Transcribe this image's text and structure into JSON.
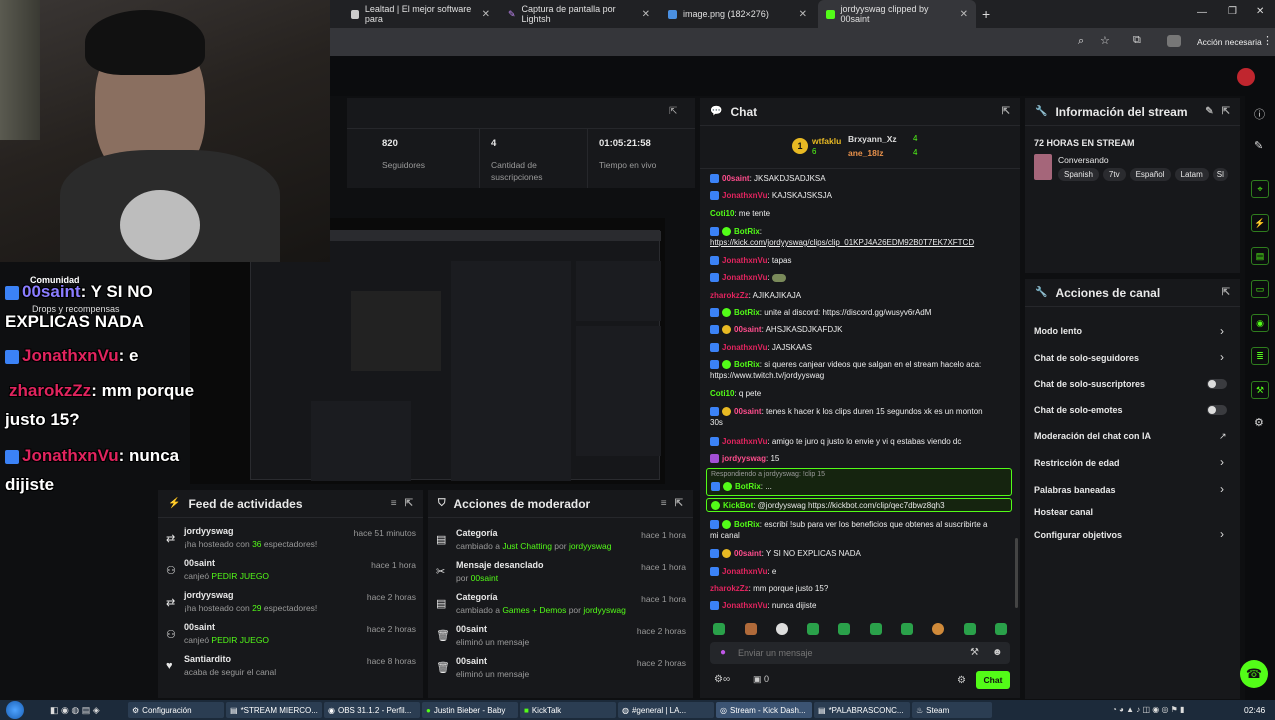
{
  "browser": {
    "tabs": [
      {
        "title": "Lealtad | El mejor software para"
      },
      {
        "title": "Captura de pantalla por Lightsh"
      },
      {
        "title": "image.png (182×276)"
      },
      {
        "title": "jordyyswag clipped by 00saint"
      }
    ],
    "action_label": "Acción necesaria"
  },
  "stats": {
    "followers": {
      "value": "820",
      "label": "Seguidores"
    },
    "subs": {
      "value": "4",
      "label": "Cantidad de suscripciones"
    },
    "uptime": {
      "value": "01:05:21:58",
      "label": "Tiempo en vivo"
    }
  },
  "chat": {
    "title": "Chat",
    "gifters": {
      "first": {
        "name": "wtfaklu",
        "count": "6"
      },
      "second": {
        "name": "Brxyann_Xz",
        "count": "4"
      },
      "third": {
        "name": "ane_18lz",
        "count": "4"
      }
    },
    "messages": [
      {
        "user": "00saint",
        "text": ": JKSAKDJSADJKSA",
        "color": "#ff4d8d"
      },
      {
        "user": "JonathxnVu",
        "text": ": KAJSKAJSKSJA",
        "color": "#e0245e"
      },
      {
        "user": "Coti10",
        "text": ": me tente",
        "color": "#53fc18"
      },
      {
        "user": "BotRix",
        "text": ":",
        "color": "#53fc18"
      },
      {
        "user": "",
        "text": "https://kick.com/jordyyswag/clips/clip_01KPJ4A26EDM92B0T7EK7XFTCD",
        "color": "#fff"
      },
      {
        "user": "JonathxnVu",
        "text": ": tapas",
        "color": "#e0245e"
      },
      {
        "user": "JonathxnVu",
        "text": ":",
        "color": "#e0245e"
      },
      {
        "user": "zharokzZz",
        "text": ": AJIKAJIKAJA",
        "color": "#e0245e"
      },
      {
        "user": "BotRix",
        "text": ": unite al discord: https://discord.gg/wusyv6rAdM",
        "color": "#53fc18"
      },
      {
        "user": "00saint",
        "text": ": AHSJKASDJKAFDJK",
        "color": "#ff4d8d"
      },
      {
        "user": "JonathxnVu",
        "text": ": JAJSKAAS",
        "color": "#e0245e"
      },
      {
        "user": "BotRix",
        "text": ": si queres canjear videos que salgan en el stream hacelo aca:",
        "color": "#53fc18"
      },
      {
        "user": "",
        "text": "https://www.twitch.tv/jordyyswag",
        "color": "#fff"
      },
      {
        "user": "Coti10",
        "text": ": q pete",
        "color": "#53fc18"
      },
      {
        "user": "00saint",
        "text": ": tenes k hacer k los clips duren 15 segundos xk es un monton",
        "color": "#ff4d8d"
      },
      {
        "user": "",
        "text": "30s",
        "color": "#fff"
      },
      {
        "user": "JonathxnVu",
        "text": ": amigo te juro q justo lo envie y vi q estabas viendo dc",
        "color": "#e0245e"
      },
      {
        "user": "jordyyswag",
        "text": ": 15",
        "color": "#ff4d8d"
      }
    ],
    "reply_to": "Respondiendo a jordyyswag: !clip 15",
    "reply_user": "BotRix",
    "reply_text": ": ...",
    "highlight_user": "KickBot",
    "highlight_text": ": @jordyyswag https://kickbot.com/clip/qec7dbwz8qh3",
    "messages2": [
      {
        "user": "BotRix",
        "text": ": escribí !sub para ver los beneficios que obtenes al suscribirte a",
        "color": "#53fc18"
      },
      {
        "user": "",
        "text": "mi canal",
        "color": "#fff"
      },
      {
        "user": "00saint",
        "text": ": Y SI NO EXPLICAS NADA",
        "color": "#ff4d8d"
      },
      {
        "user": "JonathxnVu",
        "text": ": e",
        "color": "#e0245e"
      },
      {
        "user": "zharokzZz",
        "text": ": mm porque justo 15?",
        "color": "#e0245e"
      },
      {
        "user": "JonathxnVu",
        "text": ": nunca dijiste",
        "color": "#e0245e"
      }
    ],
    "input_placeholder": "Enviar un mensaje",
    "points": "0",
    "send_label": "Chat"
  },
  "stream_info": {
    "title": "Información del stream",
    "stream_title": "72 HORAS EN STREAM",
    "category": "Conversando",
    "tags": [
      "Spanish",
      "7tv",
      "Español",
      "Latam",
      "Sl"
    ]
  },
  "channel_actions": {
    "title": "Acciones de canal",
    "items": [
      "Modo lento",
      "Chat de solo-seguidores",
      "Chat de solo-suscriptores",
      "Chat de solo-emotes",
      "Moderación del chat con IA",
      "Restricción de edad",
      "Palabras baneadas",
      "Hostear canal",
      "Configurar objetivos"
    ]
  },
  "feed": {
    "title": "Feed de actividades",
    "items": [
      {
        "name": "jordyyswag",
        "desc_a": "¡ha hosteado con ",
        "highlight": "36",
        "desc_b": " espectadores!",
        "time": "hace 51 minutos"
      },
      {
        "name": "00saint",
        "desc_a": "canjeó ",
        "highlight": "PEDIR JUEGO",
        "desc_b": "",
        "time": "hace 1 hora"
      },
      {
        "name": "jordyyswag",
        "desc_a": "¡ha hosteado con ",
        "highlight": "29",
        "desc_b": " espectadores!",
        "time": "hace 2 horas"
      },
      {
        "name": "00saint",
        "desc_a": "canjeó ",
        "highlight": "PEDIR JUEGO",
        "desc_b": "",
        "time": "hace 2 horas"
      },
      {
        "name": "Santiardito",
        "desc_a": "acaba de seguir el canal",
        "highlight": "",
        "desc_b": "",
        "time": "hace 8 horas"
      }
    ]
  },
  "mod": {
    "title": "Acciones de moderador",
    "items": [
      {
        "name": "Categoría",
        "desc_a": "cambiado a ",
        "highlight": "Just Chatting",
        "desc_b": " por ",
        "by": "jordyyswag",
        "time": "hace 1 hora"
      },
      {
        "name": "Mensaje desanclado",
        "desc_a": "por ",
        "highlight": "",
        "desc_b": "",
        "by": "00saint",
        "time": "hace 1 hora"
      },
      {
        "name": "Categoría",
        "desc_a": "cambiado a ",
        "highlight": "Games + Demos",
        "desc_b": " por ",
        "by": "jordyyswag",
        "time": "hace 1 hora"
      },
      {
        "name": "00saint",
        "desc_a": "eliminó un mensaje",
        "highlight": "",
        "desc_b": "",
        "by": "",
        "time": "hace 2 horas"
      },
      {
        "name": "00saint",
        "desc_a": "eliminó un mensaje",
        "highlight": "",
        "desc_b": "",
        "by": "",
        "time": "hace 2 horas"
      }
    ]
  },
  "overlay": {
    "community": "Comunidad",
    "drops": "Drops y recompensas",
    "lines": [
      {
        "user": "00saint",
        "text": ": Y SI NO"
      },
      {
        "user": "",
        "text": "EXPLICAS NADA"
      },
      {
        "user": "JonathxnVu",
        "text": ": e"
      },
      {
        "user": "zharokzZz",
        "text": ": mm porque"
      },
      {
        "user": "",
        "text": "justo 15?"
      },
      {
        "user": "JonathxnVu",
        "text": ": nunca"
      },
      {
        "user": "",
        "text": "dijiste"
      }
    ]
  },
  "taskbar": {
    "items": [
      "Configuración",
      "*STREAM MIERCO...",
      "OBS 31.1.2 - Perfil...",
      "Justin Bieber - Baby",
      "KickTalk",
      "#general | LA...",
      "Stream - Kick Dash...",
      "*PALABRASCONC...",
      "Steam"
    ],
    "clock": "02:46"
  }
}
